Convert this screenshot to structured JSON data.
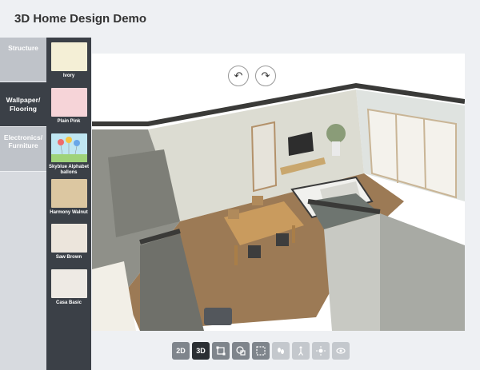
{
  "header": {
    "title": "3D Home Design Demo"
  },
  "tabs": [
    {
      "label": "Structure"
    },
    {
      "label": "Wallpaper/ Flooring"
    },
    {
      "label": "Electronics/ Furniture"
    }
  ],
  "swatches": [
    {
      "label": "Ivory",
      "color": "#f4efd6"
    },
    {
      "label": "Plain Pink",
      "color": "#f6d4d8"
    },
    {
      "label": "Skyblue Alphabet ballons",
      "color": "#bfe6f2"
    },
    {
      "label": "Harmony Walnut",
      "color": "#dcc7a1"
    },
    {
      "label": "Saw Brown",
      "color": "#ece5dc"
    },
    {
      "label": "Casa Basic",
      "color": "#eeeae4"
    }
  ],
  "toolbar": {
    "btn_2d": "2D",
    "btn_3d": "3D"
  },
  "controls": {
    "undo": "↶",
    "redo": "↷"
  }
}
